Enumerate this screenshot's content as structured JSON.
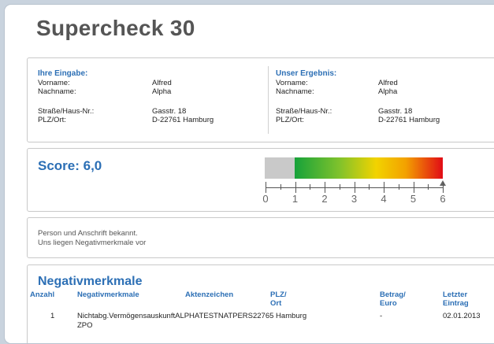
{
  "title": "Supercheck 30",
  "input": {
    "heading": "Ihre Eingabe:",
    "vorname_label": "Vorname:",
    "vorname": "Alfred",
    "nachname_label": "Nachname:",
    "nachname": "Alpha",
    "strasse_label": "Straße/Haus-Nr.:",
    "strasse": "Gasstr. 18",
    "plz_label": "PLZ/Ort:",
    "plz": "D-22761 Hamburg"
  },
  "result": {
    "heading": "Unser Ergebnis:",
    "vorname_label": "Vorname:",
    "vorname": "Alfred",
    "nachname_label": "Nachname:",
    "nachname": "Alpha",
    "strasse_label": "Straße/Haus-Nr.:",
    "strasse": "Gasstr. 18",
    "plz_label": "PLZ/Ort:",
    "plz": "D-22761 Hamburg"
  },
  "score": {
    "label": "Score: 6,0",
    "value": 6.0,
    "scale_min": 0,
    "scale_max": 6,
    "ticks": [
      "0",
      "1",
      "2",
      "3",
      "4",
      "5",
      "6"
    ],
    "colors": {
      "grey": "#c9c9c9",
      "green": "#16a23a",
      "yellow": "#f2d300",
      "red": "#e10b16"
    }
  },
  "notes": {
    "line1": "Person und Anschrift bekannt.",
    "line2": "Uns liegen Negativmerkmale vor"
  },
  "negativ": {
    "title": "Negativmerkmale",
    "headers": {
      "anzahl": "Anzahl",
      "merkmal": "Negativmerkmale",
      "akten": "Aktenzeichen",
      "plz_1": "PLZ/",
      "plz_2": "Ort",
      "betrag_1": "Betrag/",
      "betrag_2": "Euro",
      "letzter_1": "Letzter",
      "letzter_2": "Eintrag"
    },
    "rows": [
      {
        "anzahl": "1",
        "merkmal_1": "Nichtabg.VermögensauskunftALPHATESTNATPERS22765 Hamburg",
        "merkmal_2": "ZPO",
        "betrag": "-",
        "datum": "02.01.2013"
      }
    ]
  },
  "accent_color": "#2c6fb5"
}
